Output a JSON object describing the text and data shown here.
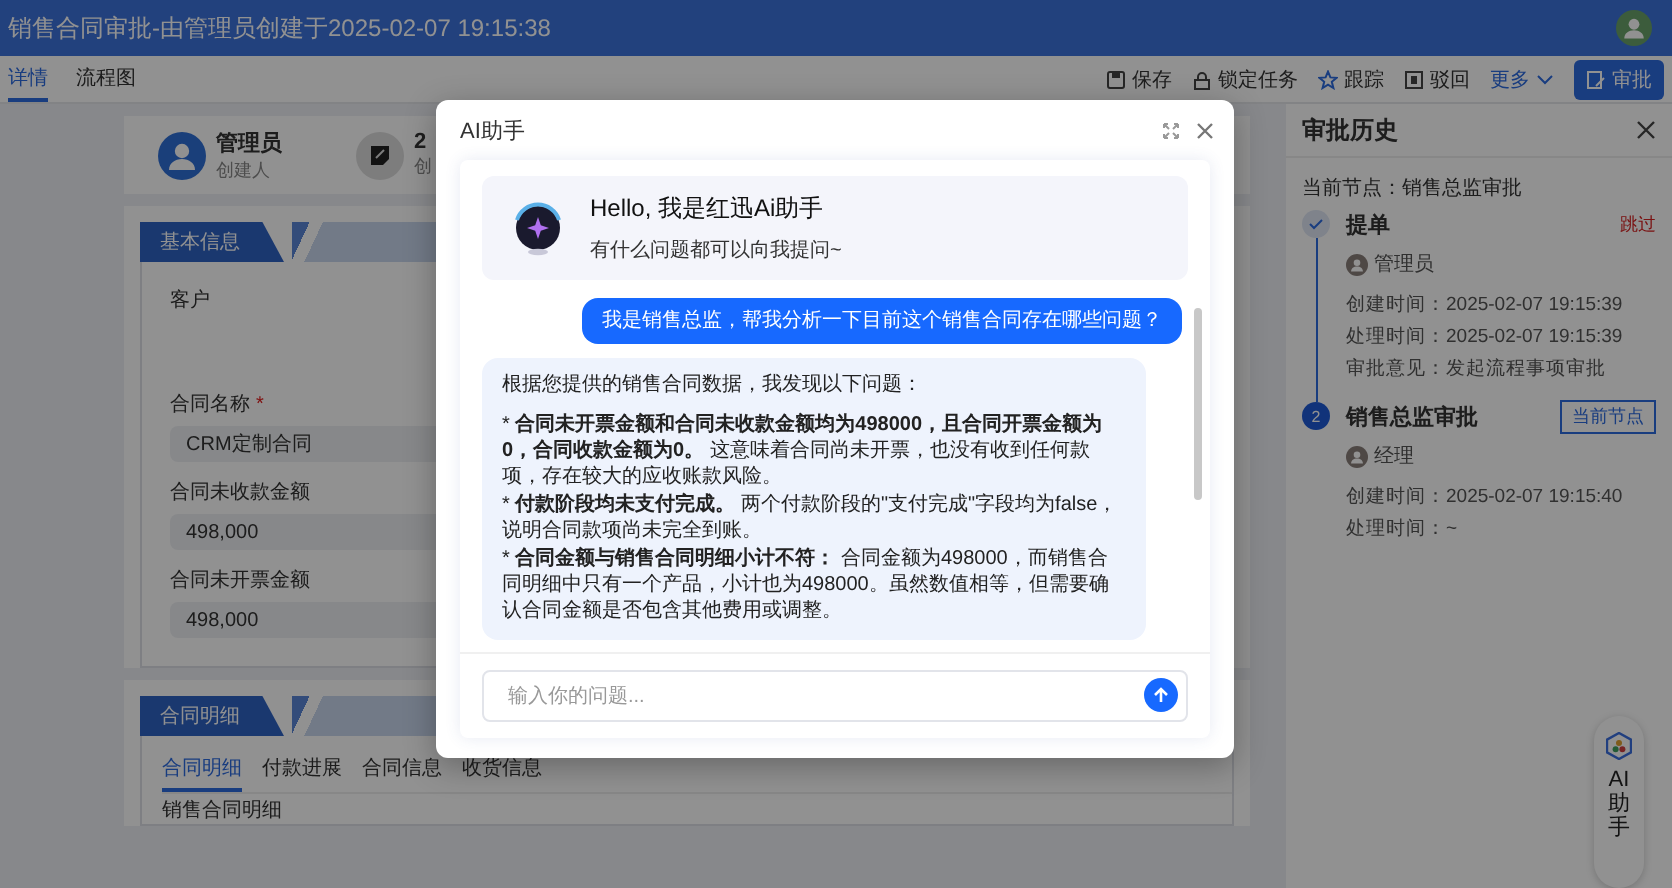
{
  "header": {
    "title": "销售合同审批-由管理员创建于2025-02-07 19:15:38"
  },
  "tabs": [
    {
      "label": "详情",
      "selected": true
    },
    {
      "label": "流程图",
      "selected": false
    }
  ],
  "toolbar": [
    {
      "kind": "save",
      "label": "保存"
    },
    {
      "kind": "lock",
      "label": "锁定任务"
    },
    {
      "kind": "star",
      "label": "跟踪"
    },
    {
      "kind": "reject",
      "label": "驳回"
    },
    {
      "kind": "more",
      "label": "更多"
    },
    {
      "kind": "primary",
      "label": "审批"
    }
  ],
  "summary": [
    {
      "kind": "avatar",
      "value": "管理员",
      "caption": "创建人"
    },
    {
      "kind": "document",
      "value": "2",
      "caption": "创"
    }
  ],
  "sections": [
    {
      "title": "基本信息",
      "fields": [
        {
          "label": "客户"
        },
        {
          "label": "合同名称",
          "required_mark": "*",
          "value": "CRM定制合同"
        },
        {
          "label": "合同未收款金额",
          "value": "498,000"
        },
        {
          "label": "合同未开票金额",
          "value": "498,000"
        }
      ]
    },
    {
      "title": "合同明细",
      "tabs": [
        {
          "label": "合同明细",
          "selected": true
        },
        {
          "label": "付款进展",
          "selected": false
        },
        {
          "label": "合同信息",
          "selected": false
        },
        {
          "label": "收货信息",
          "selected": false
        }
      ],
      "subtitle": "销售合同明细"
    }
  ],
  "history": {
    "title": "审批历史",
    "current": "当前节点：销售总监审批",
    "steps": [
      {
        "kind": "done",
        "name": "提单",
        "tag": "跳过",
        "user": "管理员",
        "lines": [
          "创建时间：2025-02-07 19:15:39",
          "处理时间：2025-02-07 19:15:39",
          "审批意见：发起流程事项审批"
        ]
      },
      {
        "kind": "current",
        "marker": "2",
        "name": "销售总监审批",
        "tag": "当前节点",
        "user": "经理",
        "lines": [
          "创建时间：2025-02-07 19:15:40",
          "处理时间：~"
        ]
      }
    ]
  },
  "fab": {
    "label": "AI助手"
  },
  "dialog": {
    "title": "AI助手",
    "welcome": {
      "title": "Hello, 我是红迅Ai助手",
      "subtitle": "有什么问题都可以向我提问~"
    },
    "messages": [
      {
        "kind": "user",
        "paragraphs": [
          "我是销售总监，帮我分析一下目前这个销售合同存在哪些问题？"
        ]
      },
      {
        "kind": "assistant",
        "paragraphs": [
          "根据您提供的销售合同数据，我发现以下问题：",
          "* **合同未开票金额和合同未收款金额均为498000，且合同开票金额为0，合同收款金额为0。** 这意味着合同尚未开票，也没有收到任何款项，存在较大的应收账款风险。",
          "* **付款阶段均未支付完成。** 两个付款阶段的\"支付完成\"字段均为false，说明合同款项尚未完全到账。",
          "* **合同金额与销售合同明细小计不符：** 合同金额为498000，而销售合同明细中只有一个产品，小计也为498000。虽然数值相等，但需要确认合同金额是否包含其他费用或调整。"
        ]
      }
    ],
    "input": {
      "placeholder": "输入你的问题..."
    }
  }
}
